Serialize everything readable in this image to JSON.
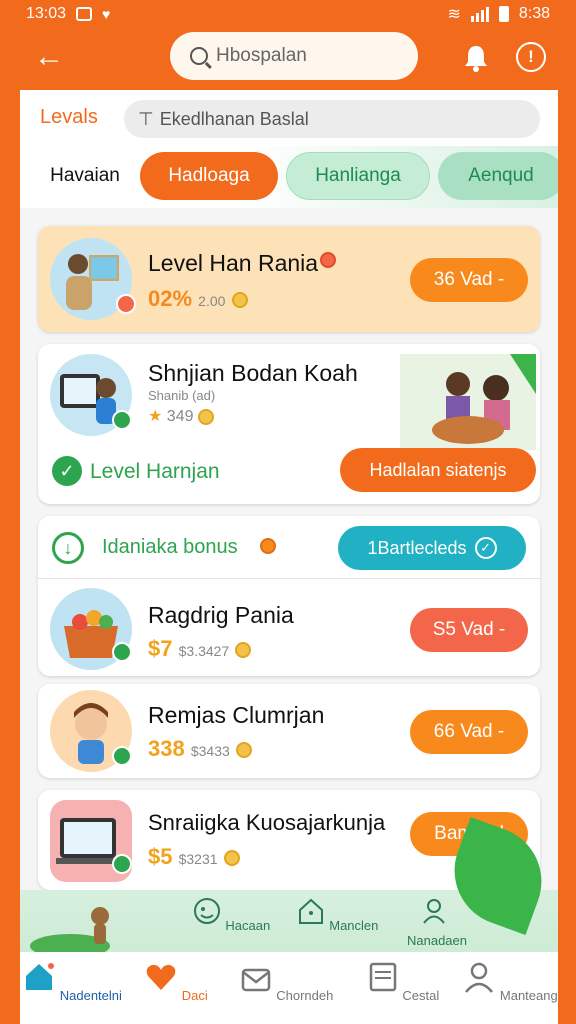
{
  "status_bar": {
    "time": "13:03",
    "battery_time": "8:38"
  },
  "header": {
    "search_placeholder": "Hbospalan"
  },
  "levels": {
    "label": "Levals",
    "input_value": "Ekedlhanan Baslal"
  },
  "tabs": [
    {
      "label": "Havaian"
    },
    {
      "label": "Hadloaga"
    },
    {
      "label": "Hanlianga"
    },
    {
      "label": "Aenqud"
    }
  ],
  "cards": [
    {
      "title": "Level Han Rania",
      "price": "02%",
      "price_small": "2.00",
      "button": "36 Vad"
    },
    {
      "title": "Shnjian Bodan Koah",
      "sub": "Shanib (ad)",
      "price": "349",
      "footer_label": "Level Harnjan",
      "button": "Hadlalan siatenjs"
    },
    {
      "title": "Ragdrig Pania",
      "price": "$7",
      "price_small": "$3.3427",
      "button": "S5 Vad"
    },
    {
      "title": "Remjas Clumrjan",
      "price": "338",
      "price_small": "$3433",
      "button": "66 Vad"
    },
    {
      "title": "Snraiigka Kuosajarkunja",
      "price": "$5",
      "price_small": "$3231",
      "button": "Bam bal"
    }
  ],
  "bonus": {
    "label": "Idaniaka bonus",
    "button": "1Bartlecleds"
  },
  "quick_actions": [
    {
      "label": "Hacaan"
    },
    {
      "label": "Manclen"
    },
    {
      "label": "Nanadaen"
    }
  ],
  "bottom_nav": [
    {
      "label": "Nadentelni"
    },
    {
      "label": "Daci"
    },
    {
      "label": "Chorndeh"
    },
    {
      "label": "Cestal"
    },
    {
      "label": "Manteang"
    }
  ],
  "colors": {
    "brand": "#f26b1d",
    "accent_green": "#2da44e",
    "teal": "#20b1c4"
  }
}
